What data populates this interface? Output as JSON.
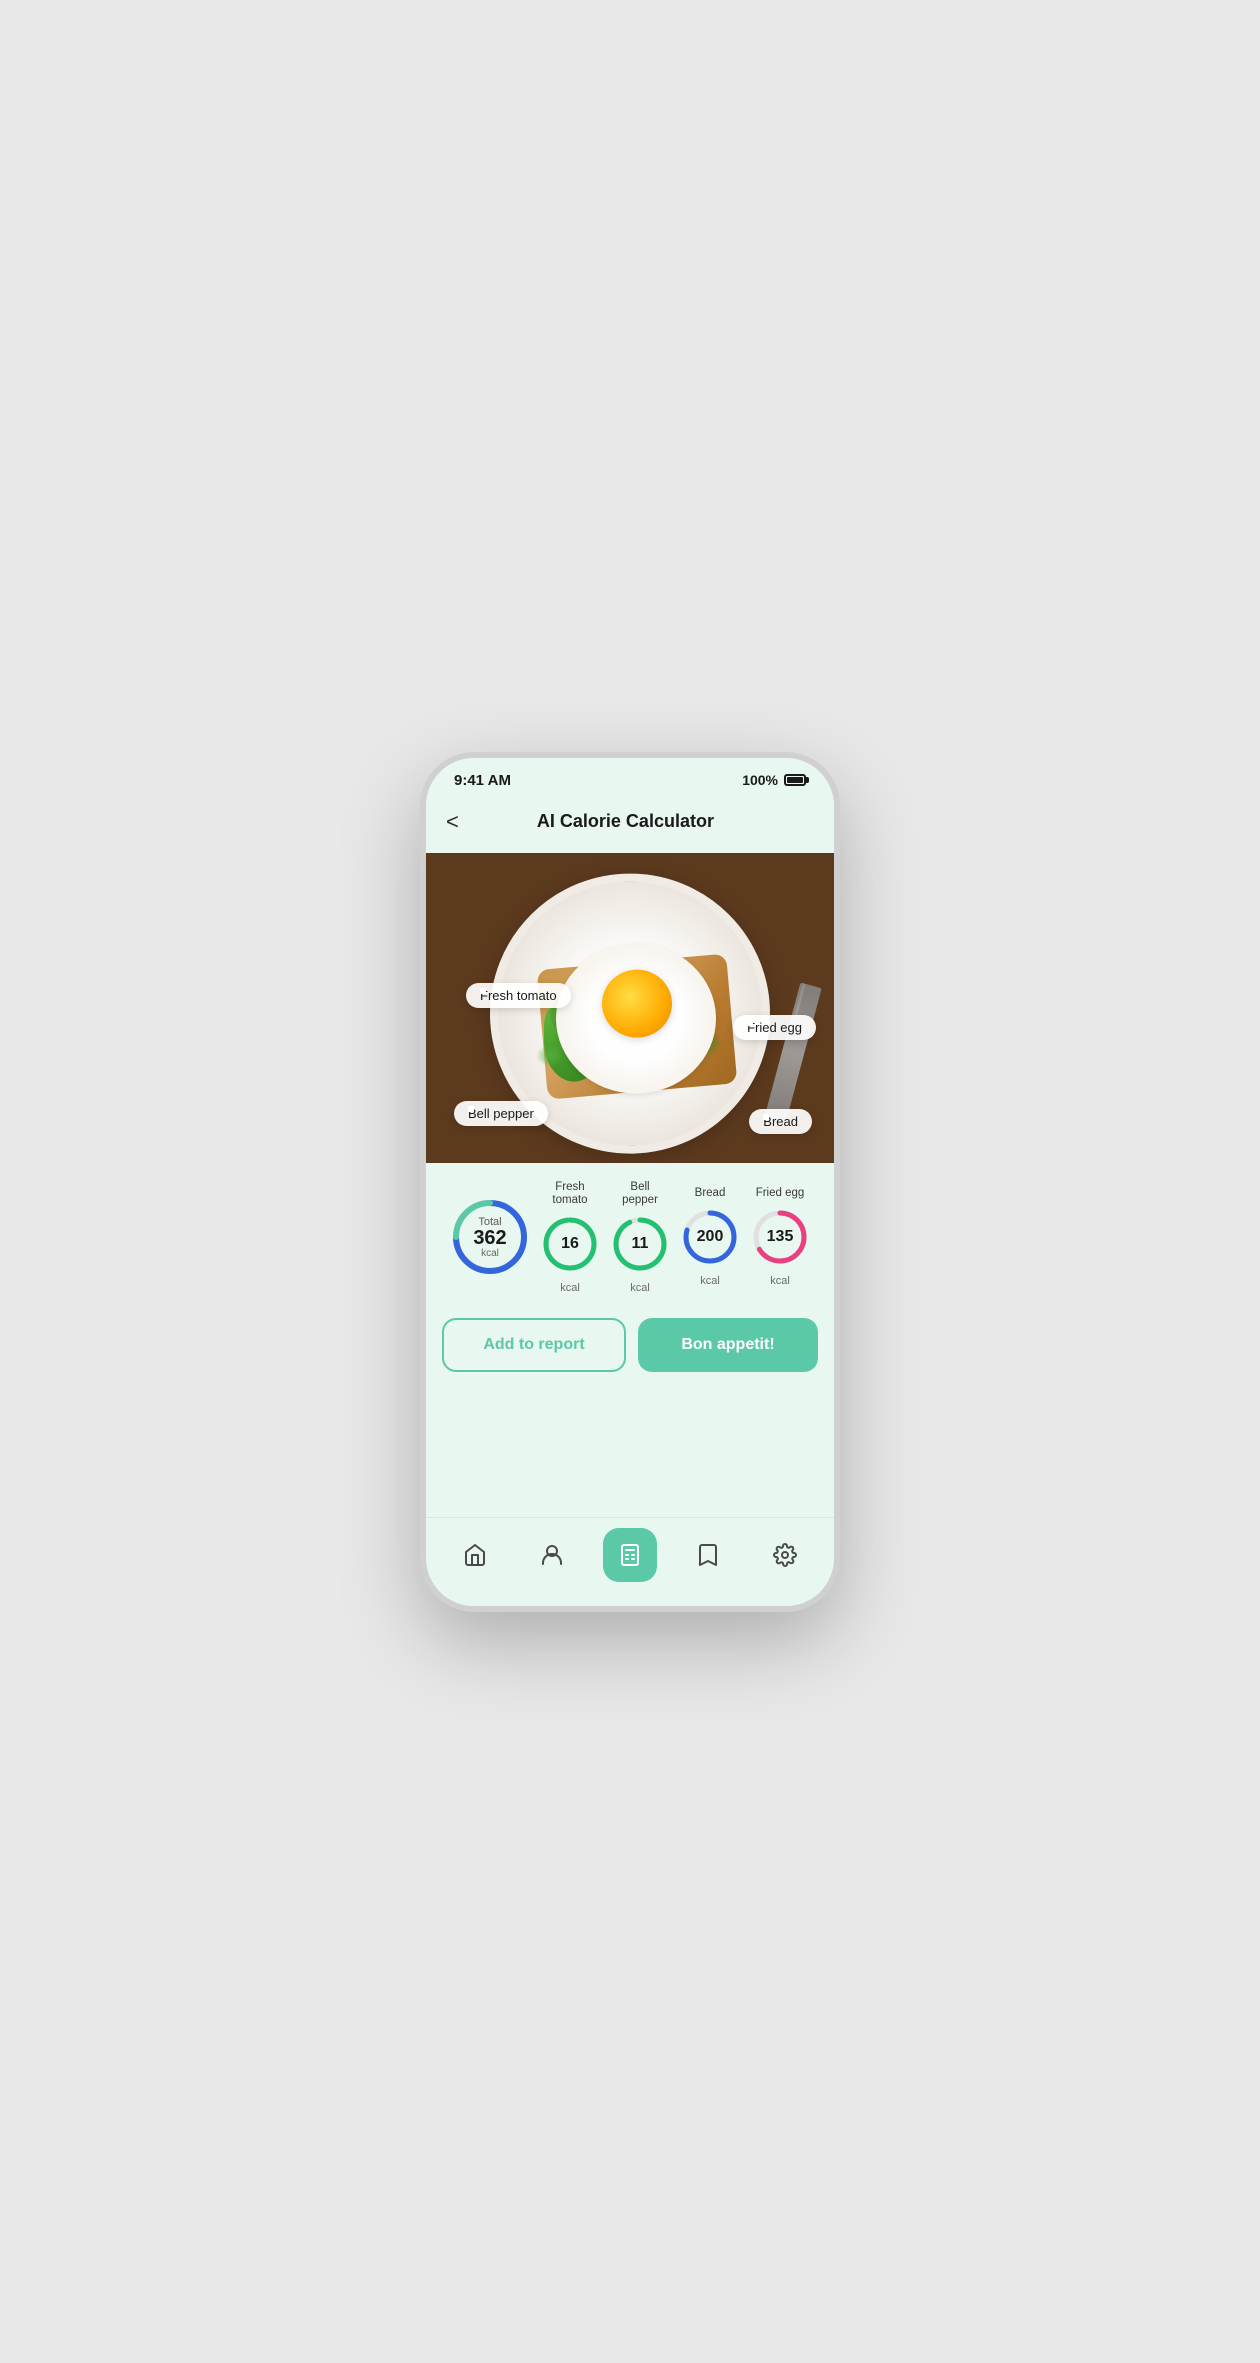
{
  "status_bar": {
    "time": "9:41 AM",
    "battery": "100%"
  },
  "header": {
    "back_label": "<",
    "title": "AI Calorie Calculator"
  },
  "food_labels": {
    "fresh_tomato": "Fresh tomato",
    "fried_egg": "Fried egg",
    "bell_pepper": "Bell pepper",
    "bread": "Bread"
  },
  "calories": {
    "total_label": "Total",
    "total_value": "362",
    "total_unit": "kcal",
    "items": [
      {
        "name": "Fresh tomato",
        "value": "16",
        "unit": "kcal",
        "color": "#22c070",
        "bg": "#e8f8f0"
      },
      {
        "name": "Bell pepper",
        "value": "11",
        "unit": "kcal",
        "color": "#22c070",
        "bg": "#e8f8f0"
      },
      {
        "name": "Bread",
        "value": "200",
        "unit": "kcal",
        "color": "#3366dd",
        "bg": "#eaf0ff"
      },
      {
        "name": "Fried egg",
        "value": "135",
        "unit": "kcal",
        "color": "#e84080",
        "bg": "#fde8f0"
      }
    ]
  },
  "buttons": {
    "add_report": "Add to report",
    "bon_appetit": "Bon appetit!"
  },
  "nav": {
    "items": [
      {
        "label": "home",
        "icon": "home"
      },
      {
        "label": "profile",
        "icon": "person"
      },
      {
        "label": "calculator",
        "icon": "calculator",
        "active": true
      },
      {
        "label": "bookmarks",
        "icon": "bookmark"
      },
      {
        "label": "settings",
        "icon": "settings"
      }
    ]
  }
}
